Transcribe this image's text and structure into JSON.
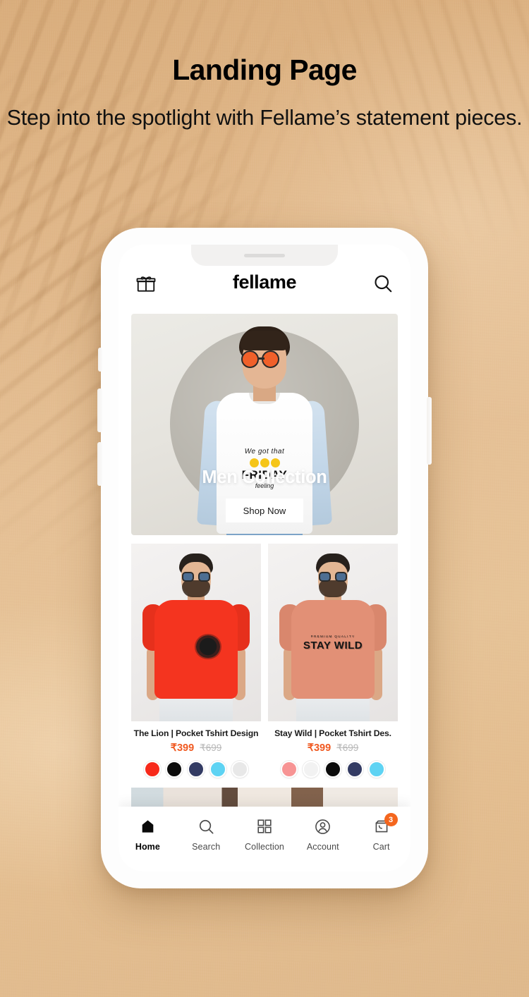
{
  "poster": {
    "title": "Landing Page",
    "subtitle": "Step into the spotlight with Fellame’s statement pieces."
  },
  "app": {
    "header": {
      "gift_icon": "gift-icon",
      "brand": "fellame",
      "search_icon": "search-icon"
    },
    "hero": {
      "title": "Men Collection",
      "cta_label": "Shop Now",
      "shirt_script": "We got that",
      "shirt_word": "FRIDAY",
      "shirt_sub": "feeling"
    },
    "products": [
      {
        "name": "The Lion | Pocket Tshirt Design",
        "price_current": "₹399",
        "price_original": "₹699",
        "shirt_color": "#f4341f",
        "sleeve_color": "#e6301c",
        "graphic": "lion",
        "swatches": [
          "#f7291a",
          "#0b0b0b",
          "#333b63",
          "#5ed3f3",
          "#e8e8e8"
        ]
      },
      {
        "name": "Stay Wild | Pocket Tshirt Des.",
        "price_current": "₹399",
        "price_original": "₹699",
        "shirt_color": "#e29076",
        "sleeve_color": "#d9876d",
        "graphic": "stay-wild",
        "graphic_small": "PREMIUM QUALITY",
        "graphic_line1": "STAY",
        "graphic_line2": "WILD",
        "swatches": [
          "#f79494",
          "#f2f2f2",
          "#0b0b0b",
          "#333b63",
          "#5ed3f3"
        ]
      }
    ],
    "bottom_nav": {
      "items": [
        {
          "label": "Home",
          "icon": "home-icon",
          "active": true,
          "badge": ""
        },
        {
          "label": "Search",
          "icon": "search-icon",
          "active": false,
          "badge": ""
        },
        {
          "label": "Collection",
          "icon": "grid-icon",
          "active": false,
          "badge": ""
        },
        {
          "label": "Account",
          "icon": "user-circle-icon",
          "active": false,
          "badge": ""
        },
        {
          "label": "Cart",
          "icon": "shopping-bag-icon",
          "active": false,
          "badge": "3"
        }
      ]
    }
  },
  "colors": {
    "accent_orange": "#f05a22",
    "badge_orange": "#f4661e",
    "background_sand": "#e3bc8e",
    "text_dark": "#111111"
  }
}
